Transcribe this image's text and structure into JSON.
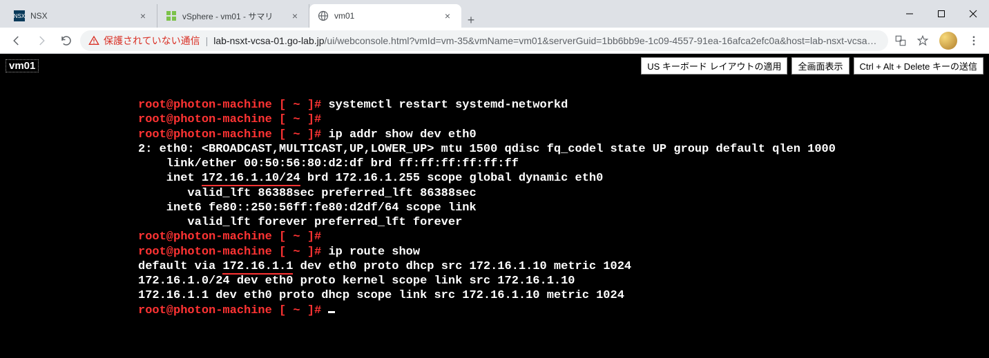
{
  "window": {
    "tabs": [
      {
        "title": "NSX",
        "active": false,
        "favicon": "nsx"
      },
      {
        "title": "vSphere - vm01 - サマリ",
        "active": false,
        "favicon": "vsphere"
      },
      {
        "title": "vm01",
        "active": true,
        "favicon": "globe"
      }
    ],
    "new_tab_glyph": "+"
  },
  "addressbar": {
    "security_label": "保護されていない通信",
    "url_host": "lab-nsxt-vcsa-01.go-lab.jp",
    "url_rest": "/ui/webconsole.html?vmId=vm-35&vmName=vm01&serverGuid=1bb6bb9e-1c09-4557-91ea-16afca2efc0a&host=lab-nsxt-vcsa-01.g…"
  },
  "console": {
    "vm_name": "vm01",
    "buttons": {
      "keyboard_layout": "US キーボード レイアウトの適用",
      "fullscreen": "全画面表示",
      "cad": "Ctrl + Alt + Delete キーの送信"
    },
    "lines": [
      {
        "type": "prompt_cmd",
        "prompt": "root@photon-machine [ ~ ]# ",
        "cmd": "systemctl restart systemd-networkd"
      },
      {
        "type": "prompt_cmd",
        "prompt": "root@photon-machine [ ~ ]# ",
        "cmd": ""
      },
      {
        "type": "prompt_cmd",
        "prompt": "root@photon-machine [ ~ ]# ",
        "cmd": "ip addr show dev eth0"
      },
      {
        "type": "out",
        "text": "2: eth0: <BROADCAST,MULTICAST,UP,LOWER_UP> mtu 1500 qdisc fq_codel state UP group default qlen 1000"
      },
      {
        "type": "out",
        "text": "    link/ether 00:50:56:80:d2:df brd ff:ff:ff:ff:ff:ff"
      },
      {
        "type": "out_underline",
        "pre": "    inet ",
        "under": "172.16.1.10/24",
        "post": " brd 172.16.1.255 scope global dynamic eth0"
      },
      {
        "type": "out",
        "text": "       valid_lft 86388sec preferred_lft 86388sec"
      },
      {
        "type": "out",
        "text": "    inet6 fe80::250:56ff:fe80:d2df/64 scope link"
      },
      {
        "type": "out",
        "text": "       valid_lft forever preferred_lft forever"
      },
      {
        "type": "prompt_cmd",
        "prompt": "root@photon-machine [ ~ ]# ",
        "cmd": ""
      },
      {
        "type": "prompt_cmd",
        "prompt": "root@photon-machine [ ~ ]# ",
        "cmd": "ip route show"
      },
      {
        "type": "out_underline",
        "pre": "default via ",
        "under": "172.16.1.1",
        "post": " dev eth0 proto dhcp src 172.16.1.10 metric 1024"
      },
      {
        "type": "out",
        "text": "172.16.1.0/24 dev eth0 proto kernel scope link src 172.16.1.10"
      },
      {
        "type": "out",
        "text": "172.16.1.1 dev eth0 proto dhcp scope link src 172.16.1.10 metric 1024"
      },
      {
        "type": "prompt_cursor",
        "prompt": "root@photon-machine [ ~ ]# "
      }
    ]
  }
}
